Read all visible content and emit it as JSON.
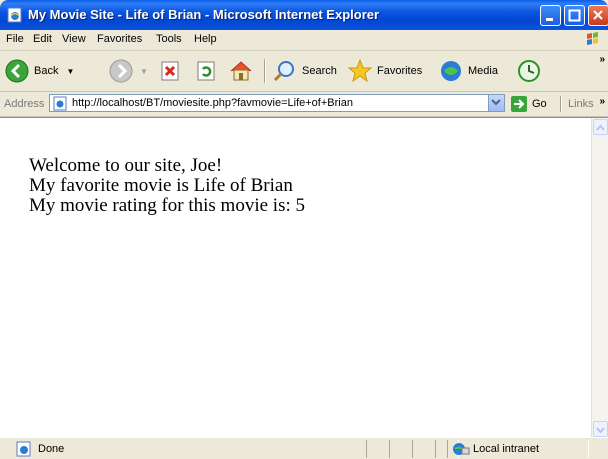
{
  "window": {
    "title": "My Movie Site - Life of Brian - Microsoft Internet Explorer"
  },
  "menu": {
    "items": [
      "File",
      "Edit",
      "View",
      "Favorites",
      "Tools",
      "Help"
    ]
  },
  "toolbar": {
    "back_label": "Back",
    "search_label": "Search",
    "favorites_label": "Favorites",
    "media_label": "Media"
  },
  "address": {
    "label": "Address",
    "url": "http://localhost/BT/moviesite.php?favmovie=Life+of+Brian",
    "go_label": "Go",
    "links_label": "Links"
  },
  "page": {
    "lines": [
      "Welcome to our site, Joe!",
      "My favorite movie is Life of Brian",
      "My movie rating for this movie is: 5"
    ]
  },
  "status": {
    "text": "Done",
    "zone": "Local intranet"
  }
}
